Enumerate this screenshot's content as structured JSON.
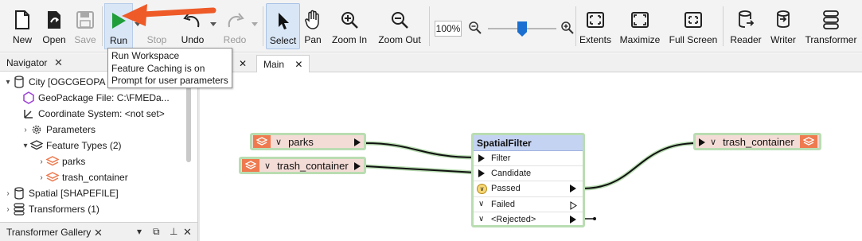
{
  "toolbar": {
    "new": "New",
    "open": "Open",
    "save": "Save",
    "run": "Run",
    "stop": "Stop",
    "undo": "Undo",
    "redo": "Redo",
    "select": "Select",
    "pan": "Pan",
    "zoom_in": "Zoom In",
    "zoom_out": "Zoom Out",
    "zoom_level": "100%",
    "extents": "Extents",
    "maximize": "Maximize",
    "full_screen": "Full Screen",
    "reader": "Reader",
    "writer": "Writer",
    "transformer": "Transformer"
  },
  "tooltip": {
    "line1": "Run Workspace",
    "line2": "Feature Caching is on",
    "line3": "Prompt for user parameters"
  },
  "navigator": {
    "title": "Navigator",
    "items": [
      {
        "label": "City [OGCGEOPA",
        "icon": "database-icon",
        "expanded": true
      },
      {
        "label": "GeoPackage File: C:\\FMEDa...",
        "icon": "dataset-icon"
      },
      {
        "label": "Coordinate System: <not set>",
        "icon": "coordinate-icon"
      },
      {
        "label": "Parameters",
        "icon": "gear-icon",
        "expanded": false
      },
      {
        "label": "Feature Types (2)",
        "icon": "layers-icon",
        "expanded": true
      },
      {
        "label": "parks",
        "icon": "feature-type-icon",
        "expanded": false
      },
      {
        "label": "trash_container",
        "icon": "feature-type-icon",
        "expanded": false
      },
      {
        "label": "Spatial [SHAPEFILE]",
        "icon": "writer-icon",
        "expanded": false
      },
      {
        "label": "Transformers (1)",
        "icon": "transformer-icon",
        "expanded": false
      }
    ]
  },
  "gallery": {
    "title": "Transformer Gallery"
  },
  "tabs": {
    "main": "Main"
  },
  "canvas": {
    "reader_parks": "parks",
    "reader_trash": "trash_container",
    "writer_trash": "trash_container",
    "transformer": {
      "title": "SpatialFilter",
      "ports": [
        "Filter",
        "Candidate",
        "Passed",
        "Failed",
        "<Rejected>"
      ]
    }
  },
  "colors": {
    "feature_fill": "#f4dcd6",
    "feature_icon": "#ef7a4f",
    "selected_border": "#b9ddb2",
    "transformer_header": "#c5d3f3",
    "run_green": "#1f9e3a",
    "annotation_arrow": "#ee5a28"
  }
}
